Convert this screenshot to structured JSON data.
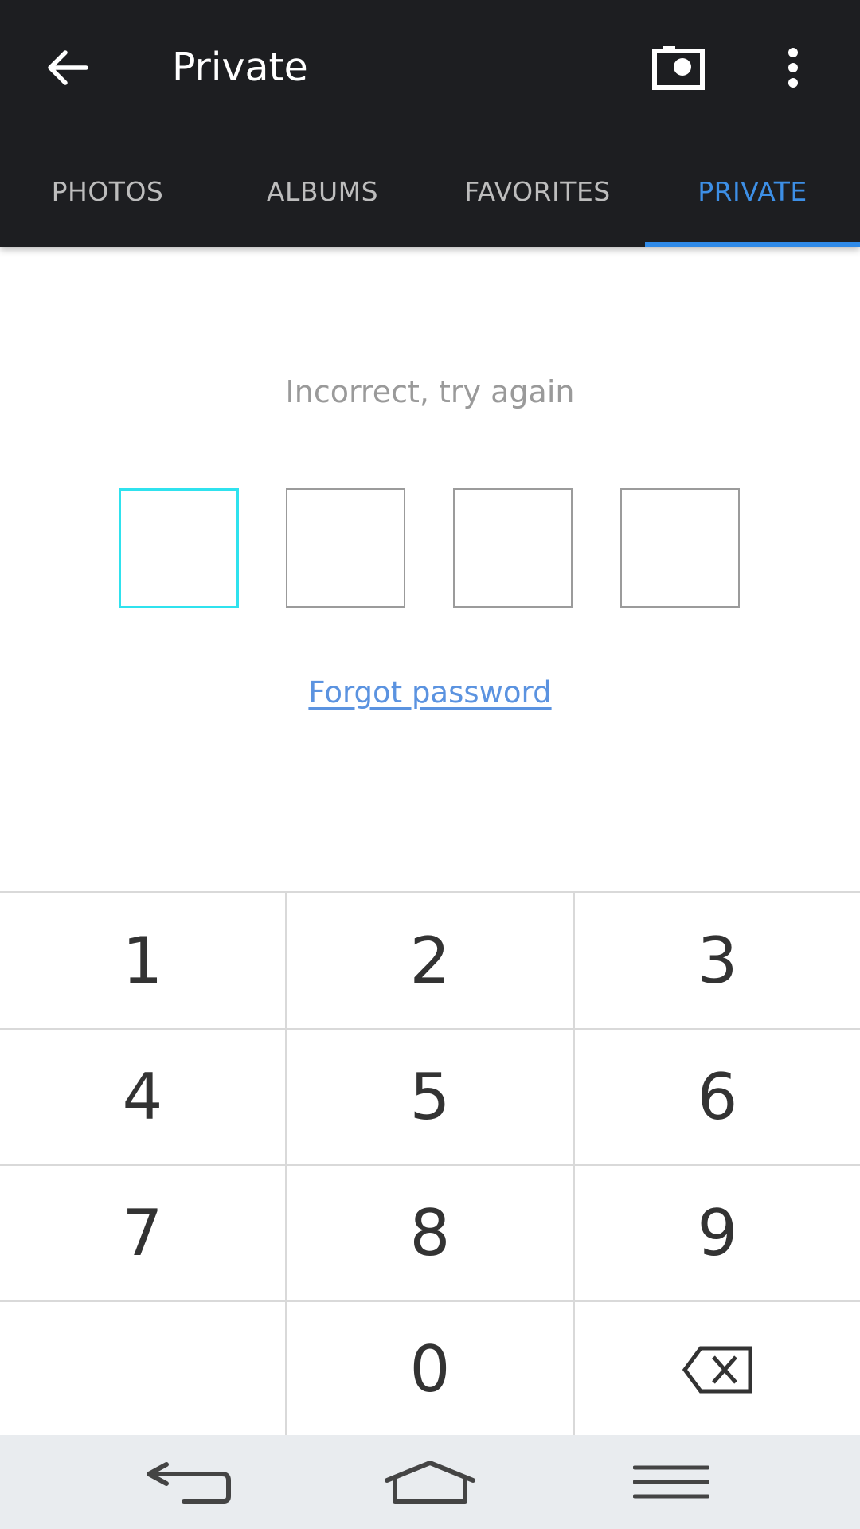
{
  "app": {
    "title": "Private"
  },
  "toolbar": {
    "back_icon": "arrow-left-icon",
    "camera_icon": "camera-icon",
    "more_icon": "more-vert-icon"
  },
  "tabs": [
    {
      "label": "PHOTOS",
      "active": false
    },
    {
      "label": "ALBUMS",
      "active": false
    },
    {
      "label": "FAVORITES",
      "active": false
    },
    {
      "label": "PRIVATE",
      "active": true
    }
  ],
  "lock": {
    "message": "Incorrect, try again",
    "pin_length": 4,
    "forgot_label": "Forgot password"
  },
  "keypad": {
    "keys": [
      "1",
      "2",
      "3",
      "4",
      "5",
      "6",
      "7",
      "8",
      "9",
      "",
      "0",
      "⌫"
    ]
  },
  "navbar": {
    "back_icon": "nav-back-icon",
    "home_icon": "nav-home-icon",
    "menu_icon": "nav-menu-icon"
  },
  "colors": {
    "appbar_bg": "#1d1e21",
    "accent": "#2f8ae8",
    "pin_focus": "#2fe2ee",
    "link": "#5b93e0"
  }
}
